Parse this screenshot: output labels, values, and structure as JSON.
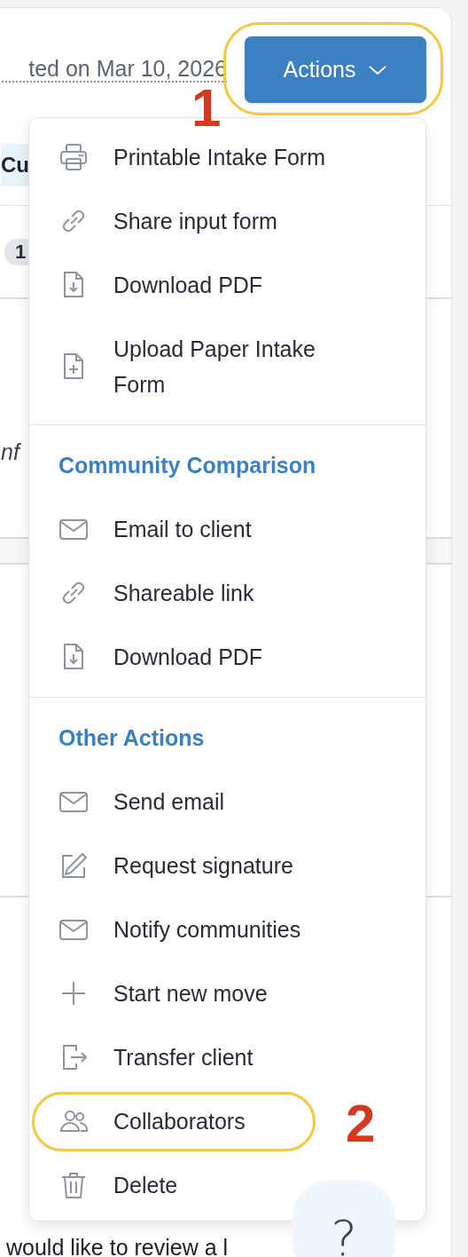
{
  "header": {
    "date_text": "ted on Mar 10, 2026",
    "actions_button": "Actions"
  },
  "background": {
    "tab": "Cu",
    "badge": "1",
    "italic_text": "nf",
    "bottom_text": "would like to review a l"
  },
  "menu": {
    "sections": [
      {
        "items": [
          {
            "kind": "print",
            "label": "Printable Intake Form"
          },
          {
            "kind": "share",
            "label": "Share input form"
          },
          {
            "kind": "download",
            "label": "Download PDF"
          },
          {
            "kind": "upload",
            "label": "Upload Paper Intake Form"
          }
        ]
      },
      {
        "heading": "Community Comparison",
        "items": [
          {
            "kind": "email",
            "label": "Email to client"
          },
          {
            "kind": "share",
            "label": "Shareable link"
          },
          {
            "kind": "download",
            "label": "Download PDF"
          }
        ]
      },
      {
        "heading": "Other Actions",
        "items": [
          {
            "kind": "email",
            "label": "Send email"
          },
          {
            "kind": "sign",
            "label": "Request signature"
          },
          {
            "kind": "email",
            "label": "Notify communities"
          },
          {
            "kind": "add",
            "label": "Start new move"
          },
          {
            "kind": "transfer",
            "label": "Transfer client"
          },
          {
            "kind": "people",
            "label": "Collaborators"
          },
          {
            "kind": "delete",
            "label": "Delete"
          }
        ]
      }
    ]
  },
  "annotations": [
    {
      "label": "1"
    },
    {
      "label": "2"
    }
  ],
  "help_button": "?"
}
